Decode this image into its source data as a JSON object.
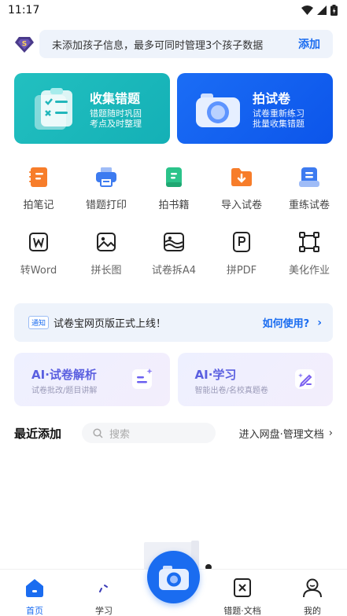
{
  "status_bar": {
    "time": "11:17"
  },
  "notice": {
    "text": "未添加孩子信息，最多可同时管理3个孩子数据",
    "action": "添加"
  },
  "big_cards": [
    {
      "title": "收集错题",
      "line1": "错题随时巩固",
      "line2": "考点及时整理",
      "color": "#18b8bb"
    },
    {
      "title": "拍试卷",
      "line1": "试卷重新练习",
      "line2": "批量收集错题",
      "color": "#1164f0"
    }
  ],
  "tools_row1": [
    {
      "label": "拍笔记",
      "icon": "notebook-icon"
    },
    {
      "label": "错题打印",
      "icon": "printer-icon"
    },
    {
      "label": "拍书籍",
      "icon": "book-icon"
    },
    {
      "label": "导入试卷",
      "icon": "import-folder-icon"
    },
    {
      "label": "重练试卷",
      "icon": "retry-paper-icon"
    }
  ],
  "tools_row2": [
    {
      "label": "转Word",
      "icon": "word-icon"
    },
    {
      "label": "拼长图",
      "icon": "long-image-icon"
    },
    {
      "label": "试卷拆A4",
      "icon": "split-a4-icon"
    },
    {
      "label": "拼PDF",
      "icon": "pdf-icon"
    },
    {
      "label": "美化作业",
      "icon": "beautify-icon"
    }
  ],
  "announcement": {
    "tag": "通知",
    "text": "试卷宝网页版正式上线！",
    "link": "如何使用?"
  },
  "ai_cards": [
    {
      "title": "AI·试卷解析",
      "subtitle": "试卷批改/题目讲解"
    },
    {
      "title": "AI·学习",
      "subtitle": "智能出卷/名校真题卷"
    }
  ],
  "recent": {
    "title": "最近添加",
    "search_placeholder": "搜索",
    "disk_link": "进入网盘·管理文档"
  },
  "nav": [
    {
      "label": "首页",
      "icon": "home-icon"
    },
    {
      "label": "学习",
      "icon": "study-icon"
    },
    {
      "label": "错题·文档",
      "icon": "mistakes-doc-icon"
    },
    {
      "label": "我的",
      "icon": "profile-icon"
    }
  ],
  "colors": {
    "accent": "#1a6cf0",
    "teal": "#18b8bb",
    "orange": "#f77d2a",
    "green": "#2bc38a"
  }
}
